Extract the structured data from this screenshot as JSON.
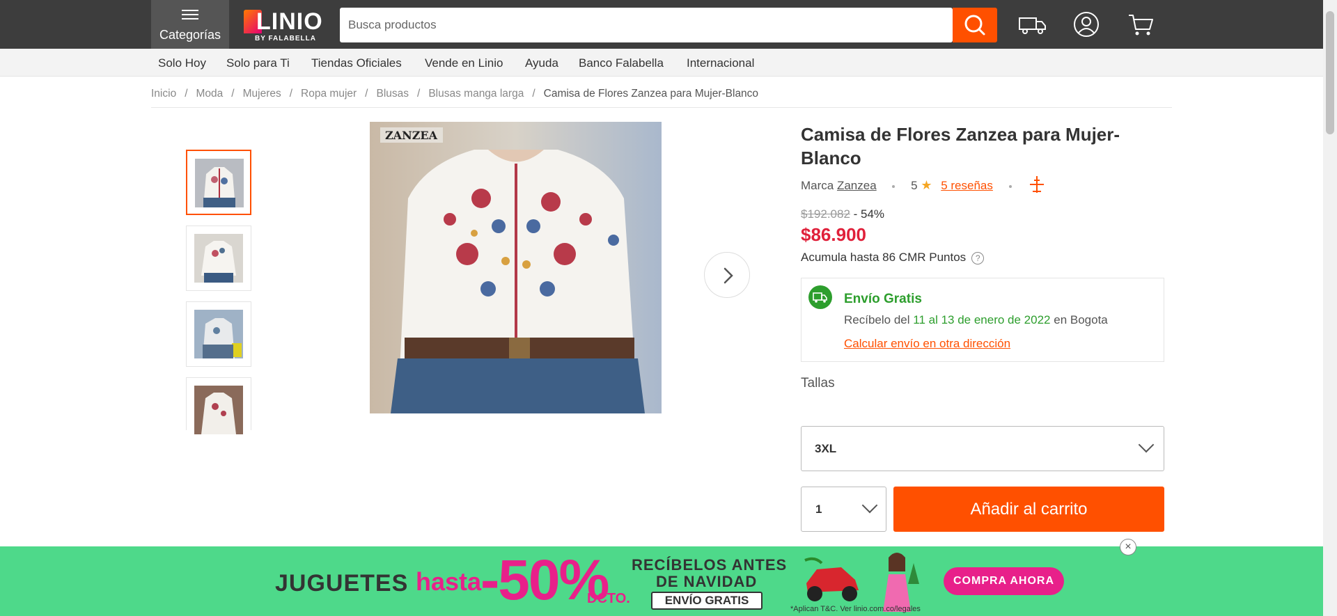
{
  "header": {
    "categories_label": "Categorías",
    "logo_word": "LINIO",
    "logo_sub": "BY FALABELLA",
    "search_placeholder": "Busca productos"
  },
  "nav": {
    "items": [
      "Solo Hoy",
      "Solo para Ti",
      "Tiendas Oficiales",
      "Vende en Linio",
      "Ayuda",
      "Banco Falabella",
      "Internacional"
    ]
  },
  "breadcrumb": {
    "items": [
      "Inicio",
      "Moda",
      "Mujeres",
      "Ropa mujer",
      "Blusas",
      "Blusas manga larga"
    ],
    "current": "Camisa de Flores Zanzea para Mujer-Blanco",
    "separator": "/"
  },
  "gallery": {
    "watermark": "ZANZEA",
    "thumbnail_count": 4,
    "active_index": 0
  },
  "product": {
    "title": "Camisa de Flores Zanzea para Mujer-Blanco",
    "brand_label": "Marca",
    "brand": "Zanzea",
    "rating": "5",
    "reviews": "5 reseñas",
    "old_price": "$192.082",
    "discount": "- 54%",
    "price": "$86.900",
    "points": "Acumula hasta 86 CMR Puntos",
    "points_help": "?"
  },
  "shipping": {
    "title": "Envío Gratis",
    "receive_prefix": "Recíbelo del",
    "receive_dates": "11 al 13 de enero de 2022",
    "receive_suffix": "en Bogota",
    "calc_link": "Calcular envío en otra dirección"
  },
  "options": {
    "sizes_label": "Tallas",
    "size_value": "3XL",
    "qty_value": "1",
    "add_to_cart": "Añadir al carrito"
  },
  "banner": {
    "juguetes": "JUGUETES",
    "hasta": "hasta",
    "percent": "-50%",
    "dcto": "DCTO.",
    "rec_line1": "RECÍBELOS ANTES",
    "rec_line2": "DE NAVIDAD",
    "envio": "ENVÍO GRATIS",
    "legal": "*Aplican T&C. Ver linio.com.co/legales",
    "cta": "COMPRA AHORA",
    "close": "×"
  },
  "colors": {
    "header_bg": "#3d3d3d",
    "accent": "#ff5000",
    "price": "#e0203a",
    "shipping_green": "#2d9e2d",
    "banner_green": "#4ed98a",
    "banner_pink": "#e8208a"
  }
}
